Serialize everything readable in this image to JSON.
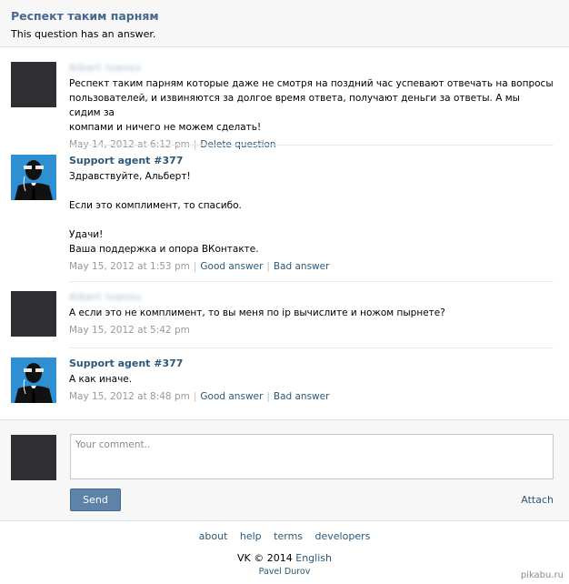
{
  "header": {
    "title": "Респект таким парням",
    "subtitle": "This question has an answer."
  },
  "posts": [
    {
      "author": "Albert Ivanov",
      "author_blurred": true,
      "lines": [
        "Респект таким парням которые даже не смотря на поздний час успевают отвечать на вопросы",
        "пользователей, и извиняются за долгое время ответа, получают деньги за ответы. А мы сидим за",
        "компами и ничего не можем сделать!"
      ],
      "date": "May 14, 2012 at 6:12 pm",
      "actions": [
        "Delete question"
      ]
    },
    {
      "author": "Support agent #377",
      "author_blurred": false,
      "lines": [
        "Здравствуйте, Альберт!",
        "",
        "Если это комплимент, то спасибо.",
        "",
        "Удачи!",
        "Ваша поддержка и опора ВКонтакте."
      ],
      "date": "May 15, 2012 at 1:53 pm",
      "actions": [
        "Good answer",
        "Bad answer"
      ]
    },
    {
      "author": "Albert Ivanov",
      "author_blurred": true,
      "lines": [
        "А если это не комплимент, то вы меня по ip вычислите и ножом пырнете?"
      ],
      "date": "May 15, 2012 at 5:42 pm",
      "actions": []
    },
    {
      "author": "Support agent #377",
      "author_blurred": false,
      "lines": [
        "А как иначе."
      ],
      "date": "May 15, 2012 at 8:48 pm",
      "actions": [
        "Good answer",
        "Bad answer"
      ]
    }
  ],
  "compose": {
    "placeholder": "Your comment..",
    "send_label": "Send",
    "attach_label": "Attach"
  },
  "footer": {
    "links": [
      "about",
      "help",
      "terms",
      "developers"
    ],
    "copyright": "VK © 2014",
    "language": "English",
    "founder": "Pavel Durov"
  },
  "watermark": "pikabu.ru",
  "colors": {
    "link": "#2b587a",
    "header_title": "#45688e",
    "button": "#5e82a8",
    "agent_avatar": "#2e8fd3",
    "user_avatar": "#2f2f33"
  }
}
